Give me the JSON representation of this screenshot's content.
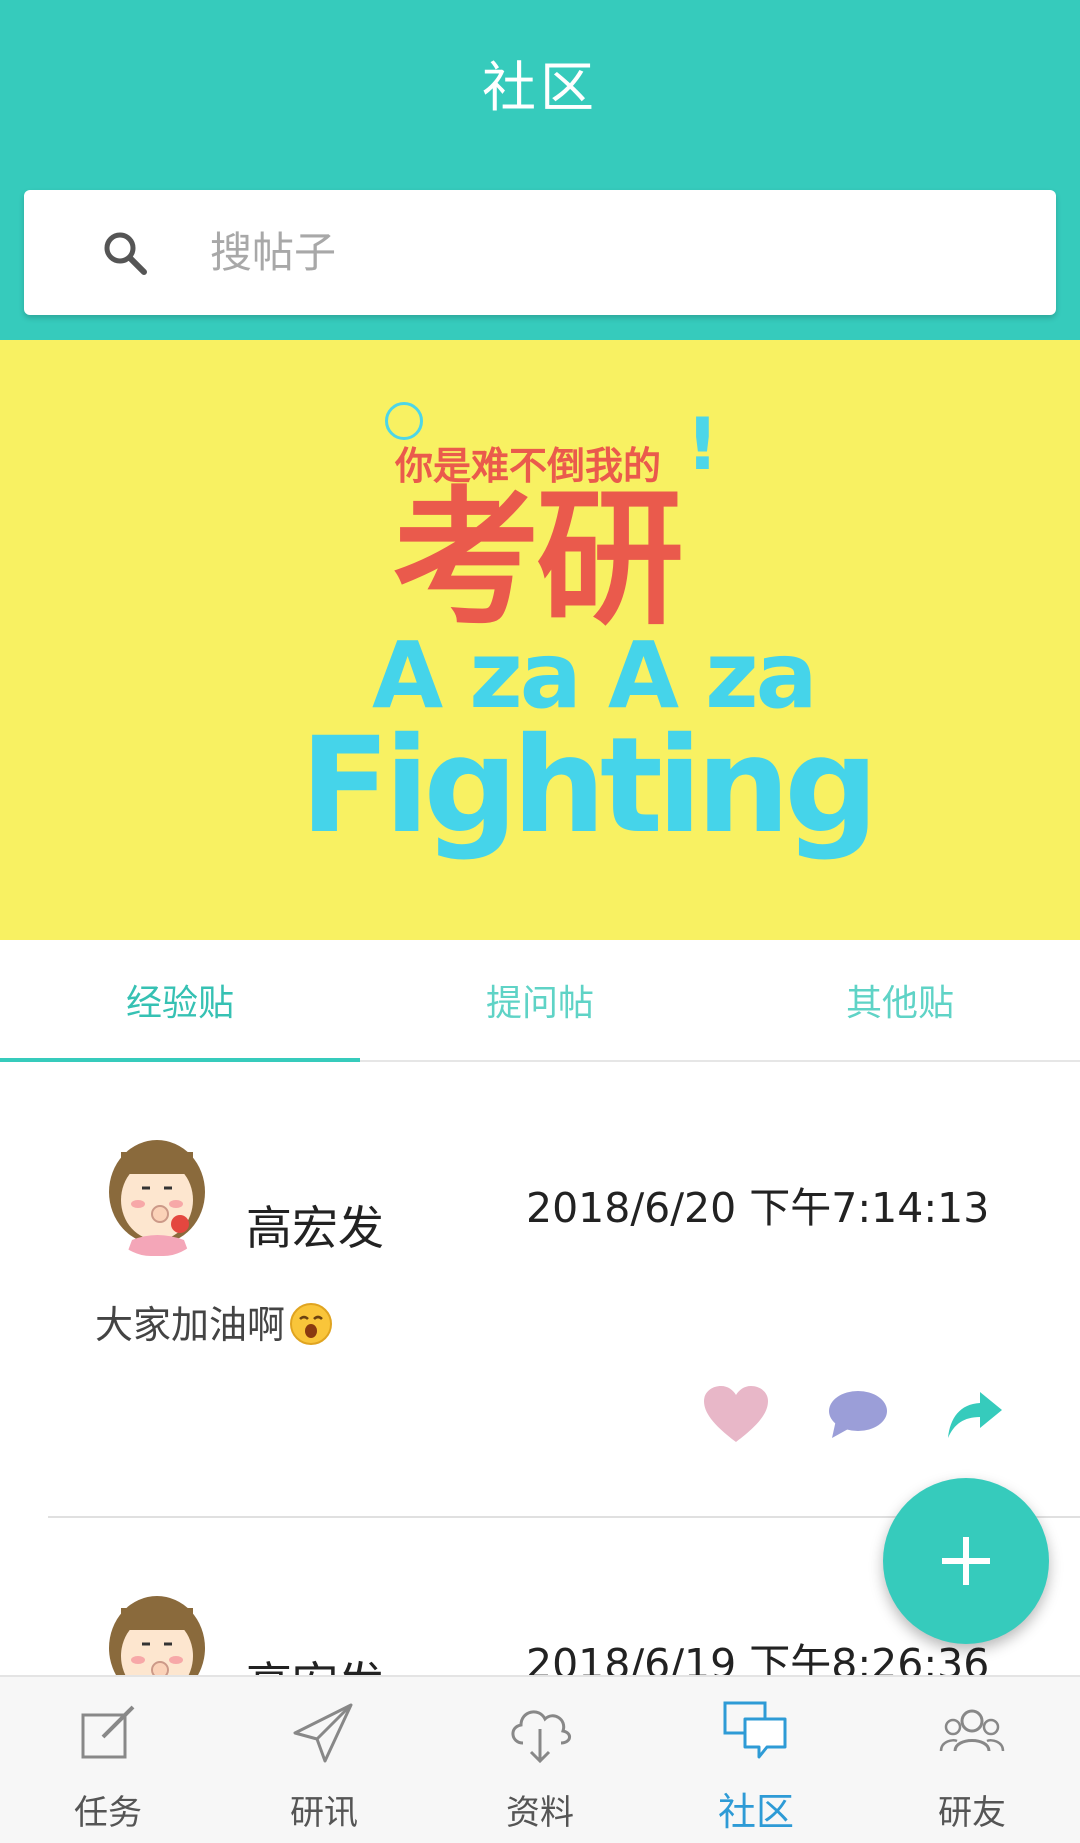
{
  "header": {
    "title": "社区"
  },
  "search": {
    "placeholder": "搜帖子"
  },
  "banner": {
    "line1": "你是难不倒我的",
    "exclamation": "!",
    "line2": "考研",
    "line3": "A za A za",
    "line4": "Fighting"
  },
  "tabs": [
    {
      "label": "经验贴",
      "active": true
    },
    {
      "label": "提问帖",
      "active": false
    },
    {
      "label": "其他贴",
      "active": false
    }
  ],
  "posts": [
    {
      "username": "高宏发",
      "time": "2018/6/20 下午7:14:13",
      "content": "大家加油啊",
      "emoji": "smiling-face-emoji"
    },
    {
      "username": "高宏发",
      "time": "2018/6/19 下午8:26:36"
    }
  ],
  "fab": {
    "icon": "plus-icon"
  },
  "bottom_nav": [
    {
      "label": "任务",
      "icon": "edit-icon",
      "active": false
    },
    {
      "label": "研讯",
      "icon": "paper-plane-icon",
      "active": false
    },
    {
      "label": "资料",
      "icon": "cloud-download-icon",
      "active": false
    },
    {
      "label": "社区",
      "icon": "chat-bubbles-icon",
      "active": true
    },
    {
      "label": "研友",
      "icon": "group-icon",
      "active": false
    }
  ],
  "colors": {
    "primary": "#36cbbc",
    "banner_bg": "#f8f162",
    "like": "#e8b7c8",
    "comment": "#9b9ed8",
    "active_nav": "#2e9bd6"
  }
}
